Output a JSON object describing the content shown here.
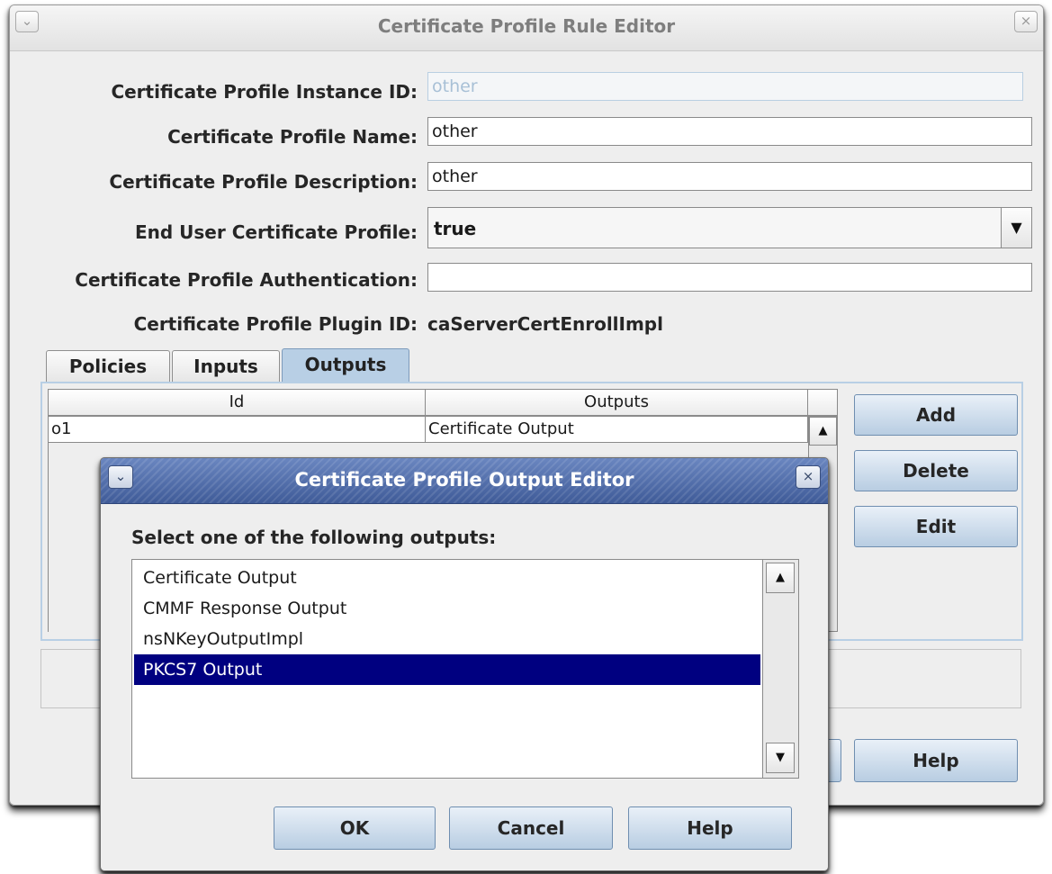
{
  "main": {
    "title": "Certificate Profile Rule Editor",
    "menu_glyph": "⌄",
    "close_glyph": "×",
    "fields": {
      "instance_id": {
        "label": "Certificate Profile Instance ID:",
        "value": "other"
      },
      "name": {
        "label": "Certificate Profile Name:",
        "value": "other"
      },
      "description": {
        "label": "Certificate Profile Description:",
        "value": "other"
      },
      "end_user": {
        "label": "End User Certificate Profile:",
        "value": "true"
      },
      "authentication": {
        "label": "Certificate Profile Authentication:",
        "value": ""
      },
      "plugin_id": {
        "label": "Certificate Profile Plugin ID:",
        "value": "caServerCertEnrollImpl"
      }
    },
    "tabs": [
      "Policies",
      "Inputs",
      "Outputs"
    ],
    "active_tab": "Outputs",
    "table": {
      "headers": [
        "Id",
        "Outputs"
      ],
      "rows": [
        {
          "id": "o1",
          "output": "Certificate Output"
        }
      ]
    },
    "side_buttons": {
      "add": "Add",
      "delete": "Delete",
      "edit": "Edit"
    },
    "help_button": "Help",
    "dropdown_glyph": "▼",
    "scroll_up_glyph": "▲",
    "scroll_down_glyph": "▼"
  },
  "dialog": {
    "title": "Certificate Profile Output Editor",
    "prompt": "Select one of the following outputs:",
    "options": [
      "Certificate Output",
      "CMMF Response Output",
      "nsNKeyOutputImpl",
      "PKCS7 Output"
    ],
    "selected_option": "PKCS7 Output",
    "buttons": {
      "ok": "OK",
      "cancel": "Cancel",
      "help": "Help"
    }
  },
  "colors": {
    "selection": "#000080",
    "tab_active": "#b8cfe5",
    "dialog_titlebar": "#4d6aa6"
  }
}
